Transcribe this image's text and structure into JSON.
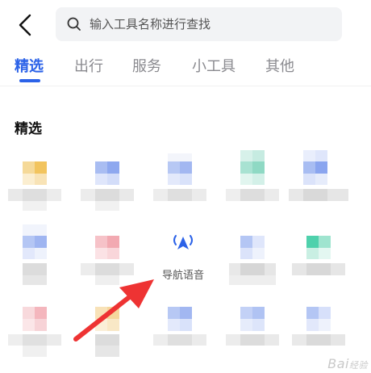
{
  "search": {
    "placeholder": "输入工具名称进行查找"
  },
  "tabs": [
    {
      "label": "精选",
      "active": true
    },
    {
      "label": "出行",
      "active": false
    },
    {
      "label": "服务",
      "active": false
    },
    {
      "label": "小工具",
      "active": false
    },
    {
      "label": "其他",
      "active": false
    }
  ],
  "section": {
    "title": "精选"
  },
  "highlighted_tool": {
    "label": "导航语音",
    "icon": "navigation-voice-icon"
  },
  "colors": {
    "accent": "#2b62e8",
    "annotation_arrow": "#ee3333"
  },
  "watermark": {
    "text": "Bai",
    "suffix": "经验"
  }
}
